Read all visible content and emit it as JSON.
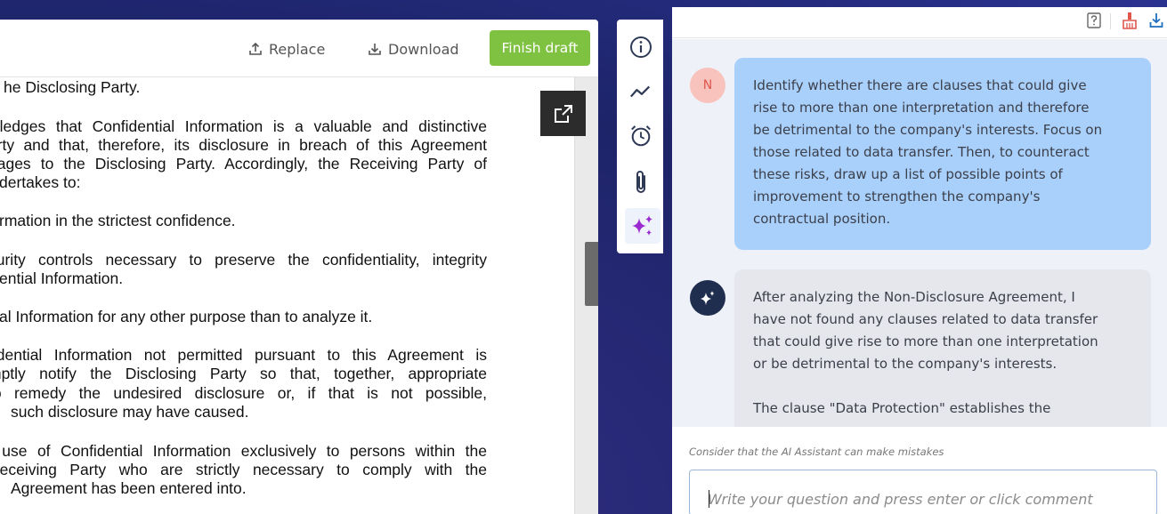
{
  "toolbar": {
    "replace_label": "Replace",
    "download_label": "Download",
    "finish_label": "Finish draft"
  },
  "document": {
    "lines": [
      "he Disclosing Party.",
      "wledges that Confidential Information is a valuable and distinctive",
      "arty and that, therefore, its disclosure in breach of this Agreement",
      "nages to the Disclosing Party. Accordingly, the Receiving Party of",
      "dertakes to:",
      "rmation in the strictest confidence.",
      "curity controls necessary to preserve the confidentiality, integrity",
      "ential Information.",
      "al Information for any other purpose than to analyze it.",
      "fidential Information not permitted pursuant to this Agreement is",
      "mptly notify the Disclosing Party so that, together, appropriate",
      "to remedy the undesired disclosure or, if that is not possible,",
      "such disclosure may have caused.",
      "l use of Confidential Information exclusively to persons within the",
      "Receiving Party who are strictly necessary to comply with the",
      "Agreement has been entered into."
    ]
  },
  "side_icons": [
    "info-icon",
    "activity-icon",
    "alarm-clock-icon",
    "paperclip-icon",
    "ai-sparkle-icon"
  ],
  "chat": {
    "user_initial": "N",
    "user_message_lines": [
      "Identify whether there are clauses that could give",
      "rise to more than one interpretation and therefore",
      "be detrimental to the company's interests. Focus on",
      "those related to data transfer. Then, to counteract",
      "these risks, draw up a list of possible points of",
      "improvement to strengthen the company's",
      "contractual position."
    ],
    "ai_message_lines": [
      "After analyzing the Non-Disclosure Agreement, I",
      "have not found any clauses related to data transfer",
      "that could give rise to more than one interpretation",
      "or be detrimental to the company's interests.",
      "",
      "The clause \"Data Protection\" establishes the"
    ],
    "disclaimer": "Consider that the AI Assistant can make mistakes",
    "input_placeholder": "Write your question and press enter or click comment"
  },
  "colors": {
    "finish_button": "#7fc241",
    "user_bubble": "#a9cffb",
    "ai_bubble": "#e5e7ec",
    "ai_avatar": "#1f2d4e",
    "user_avatar": "#f9c3bd",
    "accent_purple": "#9b2bd1"
  }
}
